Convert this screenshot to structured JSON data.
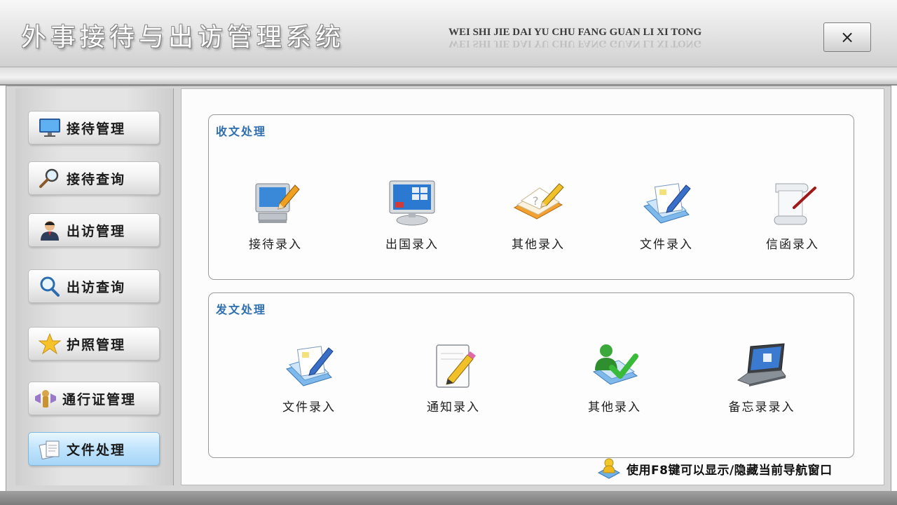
{
  "header": {
    "title": "外事接待与出访管理系统",
    "pinyin": "WEI SHI JIE DAI YU CHU FANG GUAN  LI  XI  TONG",
    "close_label": "×"
  },
  "sidebar": {
    "items": [
      {
        "label": "接待管理",
        "icon": "monitor-icon",
        "active": false
      },
      {
        "label": "接待查询",
        "icon": "magnifier-icon",
        "active": false
      },
      {
        "label": "出访管理",
        "icon": "user-icon",
        "active": false
      },
      {
        "label": "出访查询",
        "icon": "search-icon",
        "active": false
      },
      {
        "label": "护照管理",
        "icon": "star-icon",
        "active": false
      },
      {
        "label": "通行证管理",
        "icon": "badge-icon",
        "active": false
      },
      {
        "label": "文件处理",
        "icon": "documents-icon",
        "active": true
      }
    ]
  },
  "receive_group": {
    "title": "收文处理",
    "tiles": [
      {
        "label": "接待录入",
        "icon": "computer-pencil-icon"
      },
      {
        "label": "出国录入",
        "icon": "monitor-screen-icon"
      },
      {
        "label": "其他录入",
        "icon": "notebook-pencil-icon"
      },
      {
        "label": "文件录入",
        "icon": "document-pen-icon"
      },
      {
        "label": "信函录入",
        "icon": "scroll-pen-icon"
      }
    ]
  },
  "send_group": {
    "title": "发文处理",
    "tiles": [
      {
        "label": "文件录入",
        "icon": "document-pen-icon"
      },
      {
        "label": "通知录入",
        "icon": "note-pencil-icon"
      },
      {
        "label": "其他录入",
        "icon": "user-check-icon"
      },
      {
        "label": "备忘录录入",
        "icon": "laptop-icon"
      }
    ]
  },
  "hint": {
    "text": "使用F8键可以显示/隐藏当前导航窗口",
    "icon": "info-user-icon"
  },
  "colors": {
    "accent": "#2f6fb0",
    "active_nav": "#bfe3fb"
  }
}
